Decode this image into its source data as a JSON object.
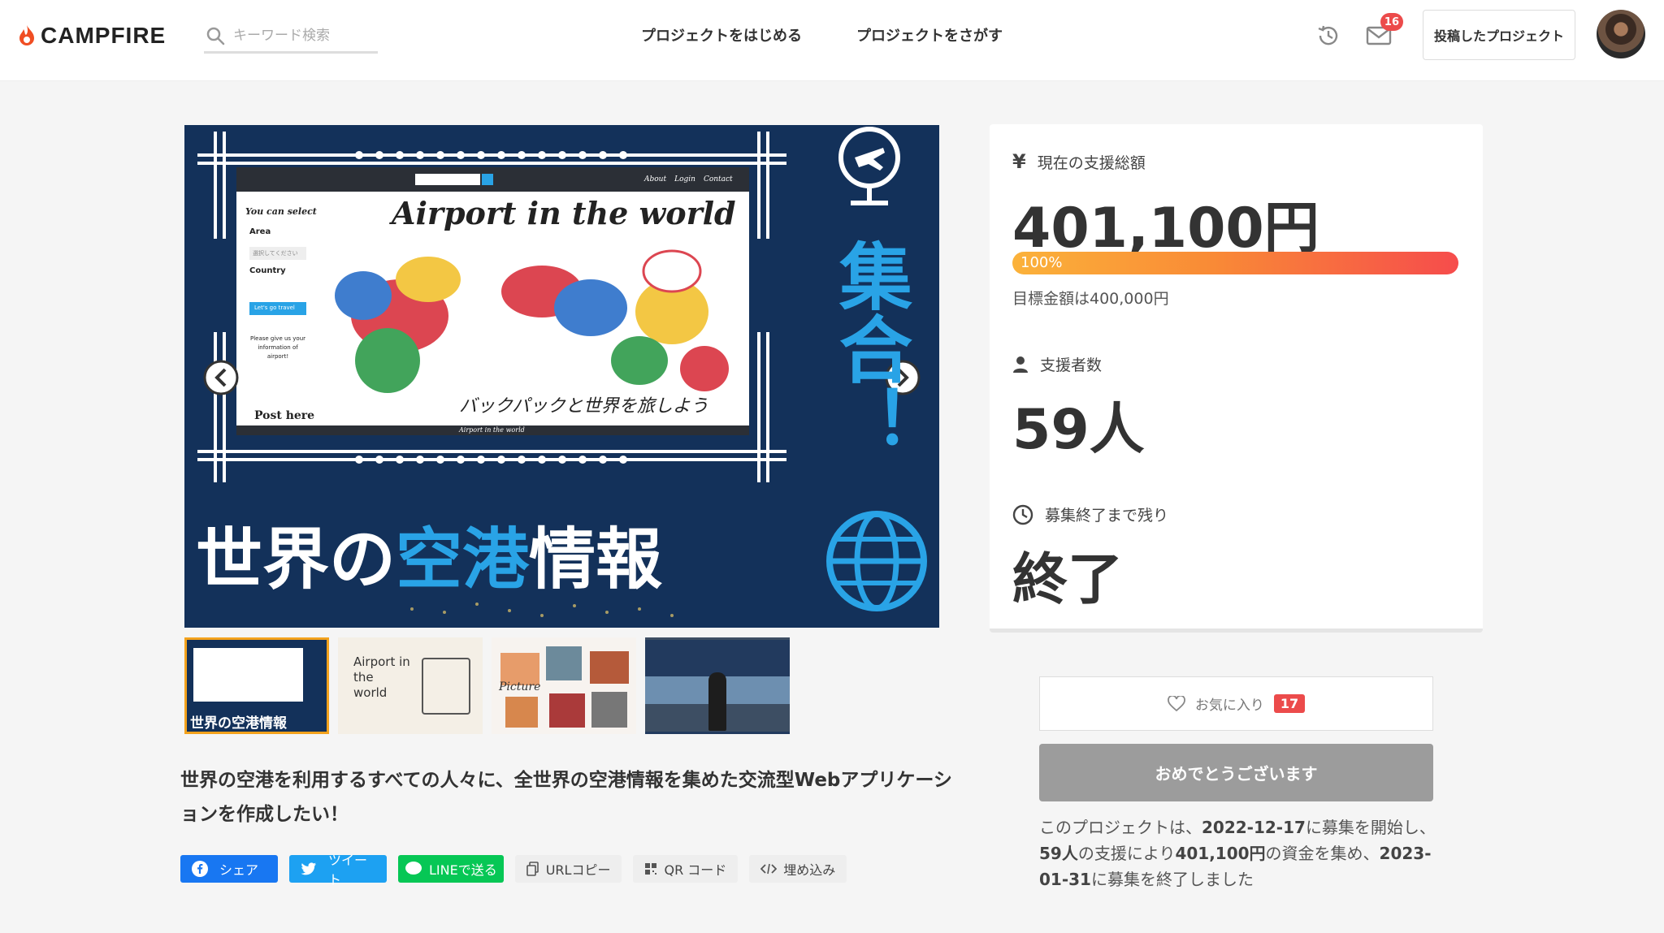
{
  "header": {
    "brand": "CAMPFIRE",
    "search_placeholder": "キーワード検索",
    "nav_start": "プロジェクトをはじめる",
    "nav_find": "プロジェクトをさがす",
    "message_count": "16",
    "posted_projects": "投稿したプロジェクト"
  },
  "hero": {
    "site_title": "Airport in the world",
    "site_subtitle": "バックパックと世界を旅しよう",
    "panel_select": "You can select",
    "panel_area": "Area",
    "panel_area_placeholder": "選択してください",
    "panel_country": "Country",
    "panel_button": "Let's go travel",
    "panel_note": "Please give us your information of airport!",
    "panel_post": "Post here",
    "footer_text": "Airport in the world",
    "vertical_text": "集合！",
    "banner_white1": "世界の",
    "banner_blue": "空港",
    "banner_white2": "情報",
    "nav_links": [
      "About",
      "Login",
      "Contact"
    ]
  },
  "thumbnails": [
    {
      "label": "世界の空港情報"
    },
    {
      "label": "Airport in the world"
    },
    {
      "label": "Picture"
    },
    {
      "label": ""
    }
  ],
  "project": {
    "title": "世界の空港を利用するすべての人々に、全世界の空港情報を集めた交流型Webアプリケーションを作成したい！"
  },
  "share": {
    "facebook": "シェア",
    "twitter": "ツイート",
    "line": "LINEで送る",
    "url": "URLコピー",
    "qr": "QR コード",
    "embed": "埋め込み"
  },
  "stats": {
    "total_label": "現在の支援総額",
    "total_amount": "401,100円",
    "progress_text": "100%",
    "progress_percent": 100,
    "goal_text": "目標金額は400,000円",
    "supporters_label": "支援者数",
    "supporters": "59人",
    "remaining_label": "募集終了まで残り",
    "remaining": "終了"
  },
  "actions": {
    "favorite": "お気に入り",
    "favorite_count": "17",
    "congrats": "おめでとうございます"
  },
  "summary": {
    "p1": "このプロジェクトは、",
    "start": "2022-12-17",
    "p2": "に募集を開始し、",
    "count": "59人",
    "p3": "の支援により",
    "amount": "401,100円",
    "p4": "の資金を集め、",
    "end": "2023-01-31",
    "p5": "に募集を終了しました"
  },
  "colors": {
    "brand": "#f04e23",
    "hero_bg": "#13315a",
    "hero_blue": "#29a3e6",
    "progress_start": "#fbb23a",
    "progress_end": "#f64c4c",
    "badge_red": "#ec4b4b",
    "facebook": "#1877f2",
    "twitter": "#1da1f2",
    "line": "#06c755"
  }
}
